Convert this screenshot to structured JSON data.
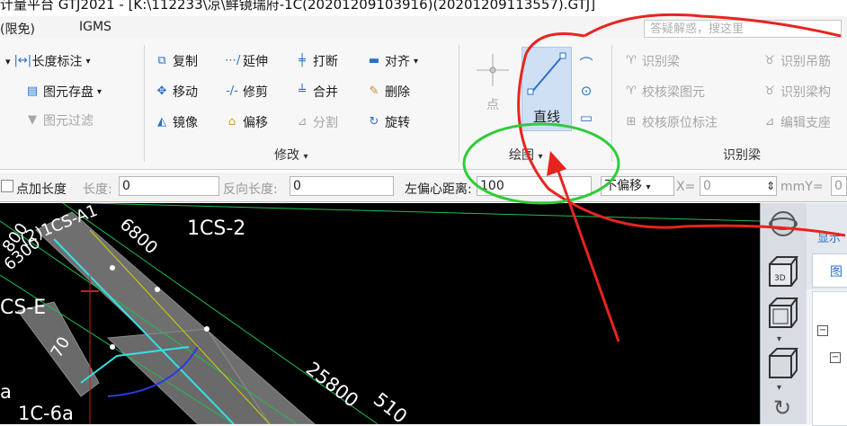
{
  "window": {
    "title": "计量平台 GTJ2021 - [K:\\112233\\凉\\鲜镜瑞府-1C(20201209103916)(20201209113557).GTJ]"
  },
  "menubar": {
    "items": [
      "(限免)",
      "IGMS"
    ]
  },
  "search": {
    "placeholder": "答疑解惑，搜这里"
  },
  "ribbon": {
    "measure": {
      "length_label": "长度标注",
      "save_label": "图元存盘",
      "filter_label": "图元过滤"
    },
    "modify": {
      "group_label": "修改",
      "copy": "复制",
      "extend": "延伸",
      "break": "打断",
      "align": "对齐",
      "move": "移动",
      "trim": "修剪",
      "merge": "合并",
      "delete": "删除",
      "mirror": "镜像",
      "offset": "偏移",
      "split": "分割",
      "rotate": "旋转"
    },
    "draw": {
      "group_label": "绘图",
      "point_label": "点",
      "line_label": "直线"
    },
    "identify": {
      "group_label": "识别梁",
      "beam": "识别梁",
      "hanger": "识别吊筋",
      "check_elements": "校核梁图元",
      "beam_struct": "识别梁构",
      "check_labels": "校核原位标注",
      "edit_support": "编辑支座"
    }
  },
  "options": {
    "point_length_label": "点加长度",
    "length_label": "长度:",
    "length_value": "0",
    "reverse_label": "反向长度:",
    "reverse_value": "0",
    "left_offset_label": "左偏心距离:",
    "left_offset_value": "100",
    "offset_mode": "不偏移",
    "x_label": "X=",
    "x_value": "0",
    "y_label": "mmY=",
    "y_value": "0"
  },
  "canvas_labels": {
    "l1": "1CS-2",
    "l2": "6800",
    "l3": "(2)1CS-A1",
    "l4": "6300",
    "l5": "CS-E",
    "l6": "70",
    "l7": "25800",
    "l8": "510",
    "l9": "1C-6a",
    "l10": "a",
    "l11": "800"
  },
  "right_panel": {
    "show_label": "显示",
    "tab_label": "图"
  },
  "colors": {
    "canvas": "#000000",
    "annotation_red": "#e8241f",
    "annotation_green": "#2fcc3a",
    "accent_blue": "#2a6fc9"
  }
}
